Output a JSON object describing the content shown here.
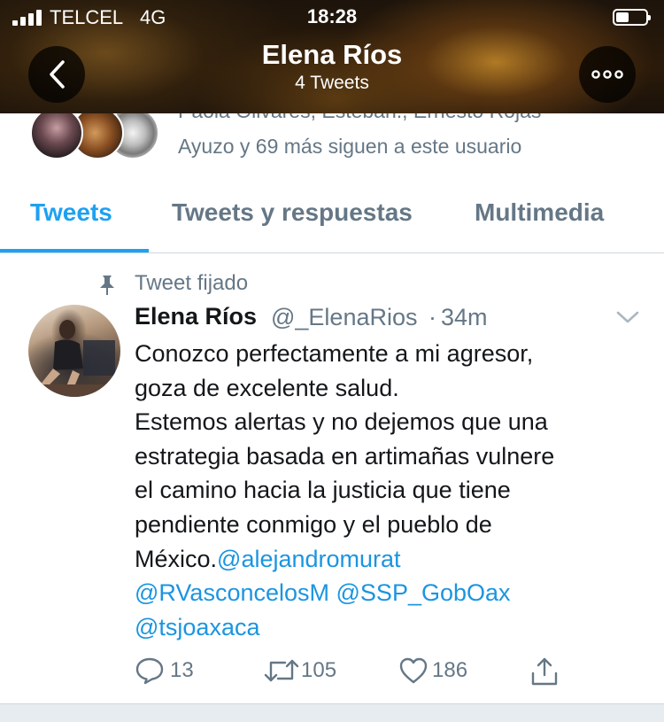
{
  "status_bar": {
    "carrier": "TELCEL",
    "network": "4G",
    "time": "18:28",
    "battery_level": 0.45,
    "signal_bars": 4
  },
  "header": {
    "name": "Elena Ríos",
    "tweet_count": "4 Tweets",
    "back_icon": "chevron-left-icon",
    "more_icon": "more-horizontal-icon"
  },
  "followers": {
    "names_line": "Paola Olivares, Esteban., Ernesto Rojas",
    "text": "Ayuzo y 69 más siguen a este usuario"
  },
  "tabs": [
    {
      "label": "Tweets",
      "active": true
    },
    {
      "label": "Tweets y respuestas",
      "active": false
    },
    {
      "label": "Multimedia",
      "active": false
    }
  ],
  "tweet": {
    "pinned_label": "Tweet fijado",
    "author_name": "Elena Ríos",
    "handle": "@_ElenaRios",
    "separator": "·",
    "time": "34m",
    "lines": [
      "Conozco perfectamente a mi agresor,",
      "goza de excelente salud.",
      "Estemos alertas y no dejemos que una",
      "estrategia basada en artimañas vulnere",
      "el camino hacia la justicia que tiene",
      "pendiente conmigo y el pueblo de"
    ],
    "last_line_text": "México.",
    "mentions": [
      "@alejandromurat",
      "@RVasconcelosM",
      "@SSP_GobOax",
      "@tsjoaxaca"
    ],
    "replies": "13",
    "retweets": "105",
    "likes": "186"
  },
  "colors": {
    "accent": "#1da1f2",
    "mention": "#1b95e0",
    "secondary_text": "#657786",
    "primary_text": "#14171a"
  }
}
